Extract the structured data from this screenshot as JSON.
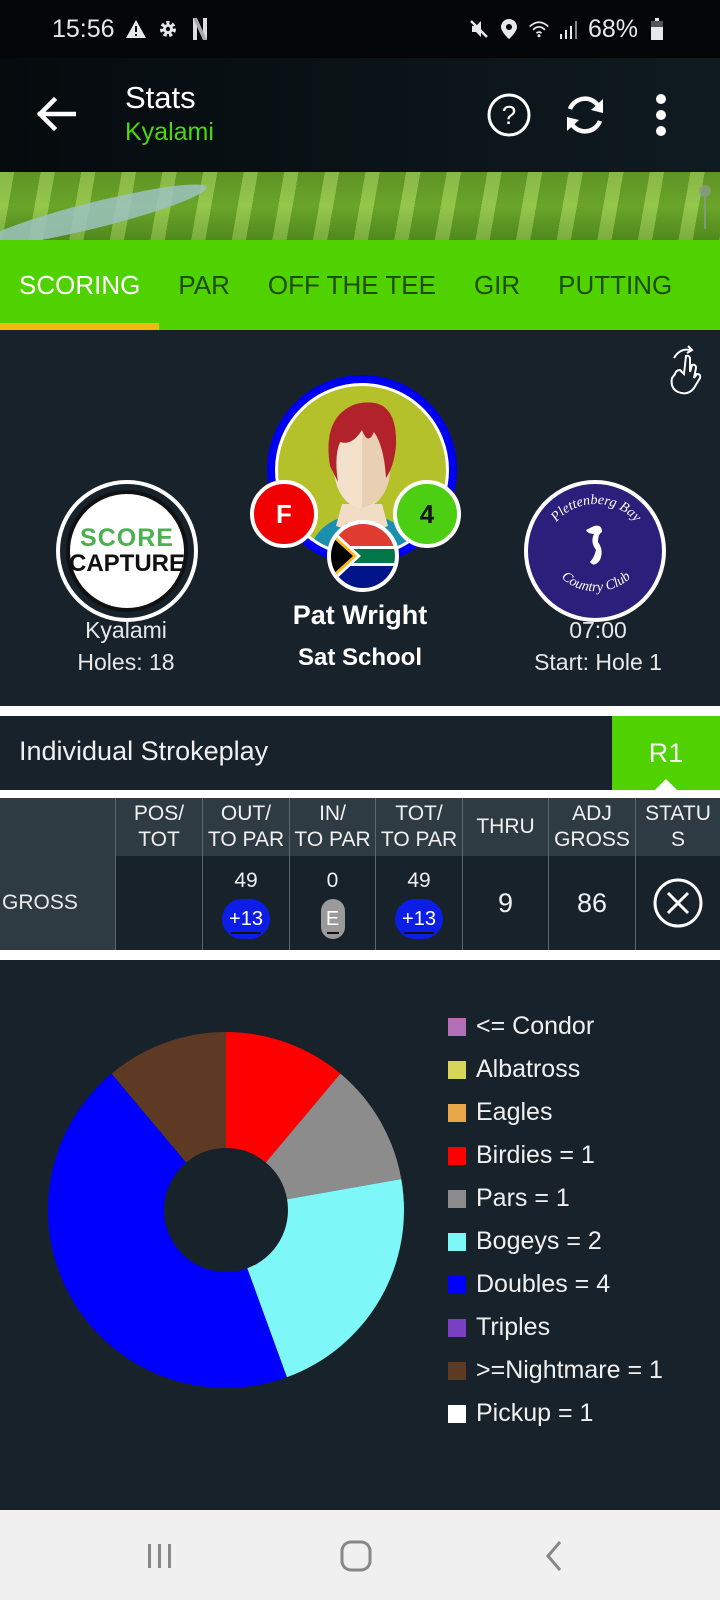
{
  "status_bar": {
    "time": "15:56",
    "left_icons": [
      "warning-icon",
      "gear-icon",
      "netflix-n-icon"
    ],
    "right_icons": [
      "mute-icon",
      "location-icon",
      "wifi-icon",
      "signal-icon"
    ],
    "battery": "68%"
  },
  "app_bar": {
    "title": "Stats",
    "subtitle": "Kyalami",
    "actions": [
      "help-icon",
      "refresh-icon",
      "more-vert-icon"
    ]
  },
  "colors": {
    "accent_green": "#50d200",
    "subtitle_green": "#4cd80e",
    "tab_indicator": "#f5b80e",
    "background": "#17222a"
  },
  "tabs": [
    {
      "label": "SCORING",
      "active": true
    },
    {
      "label": "PAR",
      "active": false
    },
    {
      "label": "OFF THE TEE",
      "active": false
    },
    {
      "label": "GIR",
      "active": false
    },
    {
      "label": "PUTTING",
      "active": false
    }
  ],
  "player": {
    "name": "Pat Wright",
    "team": "Sat School",
    "gender_badge": "F",
    "handicap_badge": "4",
    "country": "South Africa"
  },
  "course": {
    "logo_top": "SCORE",
    "logo_bottom": "CAPTURE",
    "name": "Kyalami",
    "holes": "Holes: 18"
  },
  "club": {
    "logo_line1": "Plettenberg Bay",
    "logo_line2": "Country Club",
    "tee_time": "07:00",
    "start": "Start: Hole 1"
  },
  "competition": {
    "format": "Individual Strokeplay",
    "round": "R1"
  },
  "score_table": {
    "headers": [
      "POS/\nTOT",
      "OUT/\nTO PAR",
      "IN/\nTO PAR",
      "TOT/\nTO PAR",
      "THRU",
      "ADJ\nGROSS",
      "STATU\nS"
    ],
    "row_label": "GROSS",
    "pos_tot": "",
    "out": {
      "score": "49",
      "to_par": "+13"
    },
    "in": {
      "score": "0",
      "to_par": "E"
    },
    "tot": {
      "score": "49",
      "to_par": "+13"
    },
    "thru": "9",
    "adj_gross": "86",
    "status_icon": "cancel-circle-icon"
  },
  "chart_data": {
    "type": "pie",
    "variant": "donut",
    "title": "",
    "legend_position": "right",
    "slices": [
      {
        "label": "<= Condor",
        "value": 0,
        "color": "#b36fb8",
        "legend": "<= Condor"
      },
      {
        "label": "Albatross",
        "value": 0,
        "color": "#d8d65a",
        "legend": "Albatross"
      },
      {
        "label": "Eagles",
        "value": 0,
        "color": "#e8a84a",
        "legend": "Eagles"
      },
      {
        "label": "Birdies",
        "value": 1,
        "color": "#ff0000",
        "legend": "Birdies = 1"
      },
      {
        "label": "Pars",
        "value": 1,
        "color": "#8c8c8c",
        "legend": "Pars = 1"
      },
      {
        "label": "Bogeys",
        "value": 2,
        "color": "#7df7f7",
        "legend": "Bogeys = 2"
      },
      {
        "label": "Doubles",
        "value": 4,
        "color": "#0000ff",
        "legend": "Doubles = 4"
      },
      {
        "label": "Triples",
        "value": 0,
        "color": "#7b3fc4",
        "legend": "Triples"
      },
      {
        "label": ">=Nightmare",
        "value": 1,
        "color": "#5e3a24",
        "legend": ">=Nightmare = 1"
      },
      {
        "label": "Pickup",
        "value": 1,
        "color": "#ffffff",
        "legend": "Pickup = 1",
        "drawn": false
      }
    ]
  },
  "nav_bar": {
    "buttons": [
      "recents-icon",
      "home-icon",
      "back-icon"
    ]
  }
}
